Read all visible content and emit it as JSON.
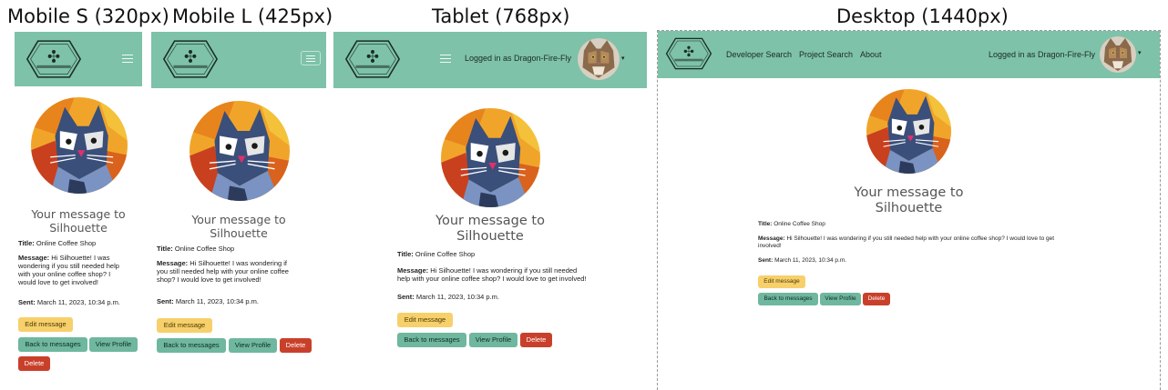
{
  "labels": {
    "mobile_s": "Mobile S (320px)",
    "mobile_l": "Mobile L (425px)",
    "tablet": "Tablet (768px)",
    "desktop": "Desktop (1440px)"
  },
  "brand": {
    "logo_text": "Developer Connect"
  },
  "nav": {
    "developer_search": "Developer Search",
    "project_search": "Project Search",
    "about": "About",
    "logged_in": "Logged in as Dragon-Fire-Fly"
  },
  "message": {
    "heading_line1": "Your message to",
    "heading_line2": "Silhouette",
    "title_label": "Title:",
    "title_value": "Online Coffee Shop",
    "message_label": "Message:",
    "message_value": "Hi Silhouette! I was wondering if you still needed help with your online coffee shop? I would love to get involved!",
    "sent_label": "Sent:",
    "sent_value": "March 11, 2023, 10:34 p.m."
  },
  "buttons": {
    "edit": "Edit message",
    "back": "Back to messages",
    "view_profile": "View Profile",
    "delete": "Delete"
  },
  "colors": {
    "navbar": "#7dc2a9",
    "edit_button": "#f7d06b",
    "green_button": "#6fb79e",
    "delete_button": "#c9402a"
  },
  "icons": {
    "hamburger": "hamburger-icon",
    "caret": "caret-down-icon",
    "avatar": "cat-avatar",
    "profile_image": "cubist-cat-portrait"
  }
}
